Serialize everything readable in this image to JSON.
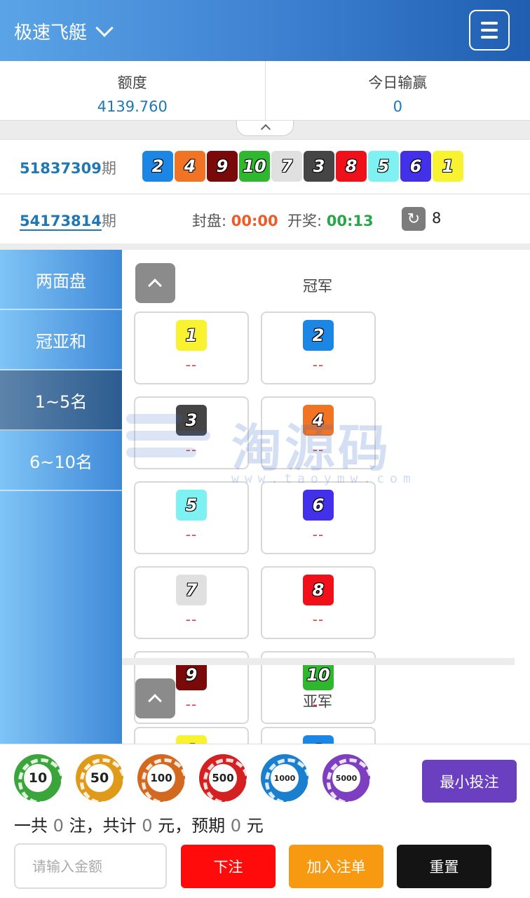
{
  "header": {
    "title": "极速飞艇"
  },
  "balance": {
    "credit_label": "额度",
    "credit_value": "4139.760",
    "today_label": "今日输赢",
    "today_value": "0"
  },
  "last_draw": {
    "issue": "51837309",
    "suffix": "期",
    "numbers": [
      {
        "n": "2",
        "color": "#1b86e3"
      },
      {
        "n": "4",
        "color": "#f07424"
      },
      {
        "n": "9",
        "color": "#7a0a0a"
      },
      {
        "n": "10",
        "color": "#2fb82f"
      },
      {
        "n": "7",
        "color": "#e0e0e0"
      },
      {
        "n": "3",
        "color": "#454545"
      },
      {
        "n": "8",
        "color": "#f0101a"
      },
      {
        "n": "5",
        "color": "#7ef2f2"
      },
      {
        "n": "6",
        "color": "#4231e8"
      },
      {
        "n": "1",
        "color": "#f8f231"
      }
    ]
  },
  "current": {
    "issue": "54173814",
    "suffix": "期",
    "close_label": "封盘:",
    "close_time": "00:00",
    "open_label": "开奖:",
    "open_time": "00:13",
    "refresh_count": "8"
  },
  "sidebar": {
    "items": [
      {
        "label": "两面盘",
        "active": false
      },
      {
        "label": "冠亚和",
        "active": false
      },
      {
        "label": "1~5名",
        "active": true
      },
      {
        "label": "6~10名",
        "active": false
      }
    ]
  },
  "sections": [
    {
      "title": "冠军",
      "cells": [
        {
          "n": "1",
          "color": "#f8f231",
          "odds": "--"
        },
        {
          "n": "2",
          "color": "#1b86e3",
          "odds": "--"
        },
        {
          "n": "3",
          "color": "#454545",
          "odds": "--"
        },
        {
          "n": "4",
          "color": "#f07424",
          "odds": "--"
        },
        {
          "n": "5",
          "color": "#7ef2f2",
          "odds": "--"
        },
        {
          "n": "6",
          "color": "#4231e8",
          "odds": "--"
        },
        {
          "n": "7",
          "color": "#e0e0e0",
          "odds": "--"
        },
        {
          "n": "8",
          "color": "#f0101a",
          "odds": "--"
        },
        {
          "n": "9",
          "color": "#7a0a0a",
          "odds": "--"
        },
        {
          "n": "10",
          "color": "#2fb82f",
          "odds": "--"
        }
      ]
    },
    {
      "title": "亚军"
    }
  ],
  "watermark": {
    "main": "淘源码",
    "sub": "www.taoymw.com"
  },
  "chips": [
    {
      "value": "10",
      "color": "#3aa53a"
    },
    {
      "value": "50",
      "color": "#e09a1a"
    },
    {
      "value": "100",
      "color": "#d2691e"
    },
    {
      "value": "500",
      "color": "#d42020"
    },
    {
      "value": "1000",
      "color": "#1b7fd0"
    },
    {
      "value": "5000",
      "color": "#7d3fc0"
    }
  ],
  "min_bet_label": "最小投注",
  "summary": {
    "prefix": "一共",
    "count": "0",
    "mid1": "注，共计",
    "total": "0",
    "mid2": "元，预期",
    "expect": "0",
    "suffix": "元"
  },
  "amount_placeholder": "请输入金额",
  "buttons": {
    "bet": "下注",
    "add": "加入注单",
    "reset": "重置"
  },
  "colors": {
    "header_from": "#5aa4e6",
    "header_to": "#1f5eb0",
    "accent_blue": "#1f78b4"
  }
}
